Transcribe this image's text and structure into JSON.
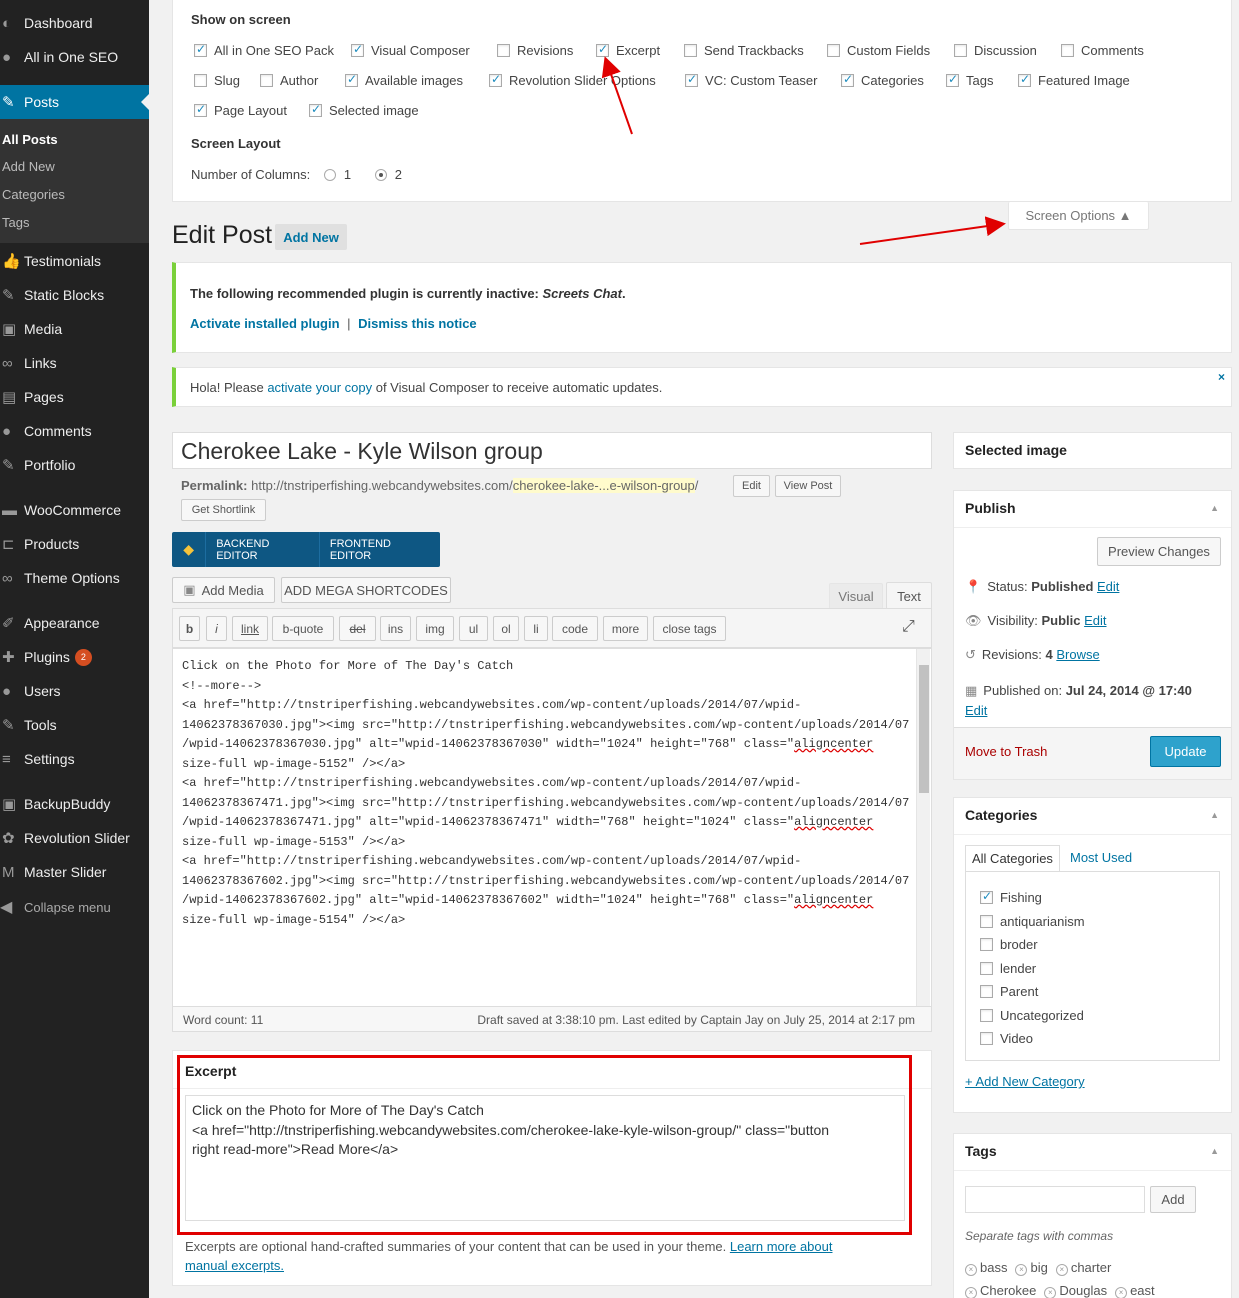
{
  "sidebar": {
    "items": [
      {
        "label": "Dashboard",
        "icon": "dashboard-icon",
        "glyph": "◐"
      },
      {
        "label": "All in One SEO",
        "icon": "seo-icon",
        "glyph": "●"
      },
      {
        "label": "Posts",
        "icon": "pin-icon",
        "glyph": "✎"
      },
      {
        "label": "Testimonials",
        "icon": "thumbs-up-icon",
        "glyph": "👍"
      },
      {
        "label": "Static Blocks",
        "icon": "pin-icon",
        "glyph": "✎"
      },
      {
        "label": "Media",
        "icon": "media-icon",
        "glyph": "▣"
      },
      {
        "label": "Links",
        "icon": "link-icon",
        "glyph": "∞"
      },
      {
        "label": "Pages",
        "icon": "page-icon",
        "glyph": "▤"
      },
      {
        "label": "Comments",
        "icon": "comment-icon",
        "glyph": "●"
      },
      {
        "label": "Portfolio",
        "icon": "pin-icon",
        "glyph": "✎"
      },
      {
        "label": "WooCommerce",
        "icon": "woo-icon",
        "glyph": "▬"
      },
      {
        "label": "Products",
        "icon": "cart-icon",
        "glyph": "⊏"
      },
      {
        "label": "Theme Options",
        "icon": "infinity-icon",
        "glyph": "∞"
      },
      {
        "label": "Appearance",
        "icon": "brush-icon",
        "glyph": "✐"
      },
      {
        "label": "Plugins",
        "icon": "plugin-icon",
        "glyph": "✚",
        "badge": "2"
      },
      {
        "label": "Users",
        "icon": "user-icon",
        "glyph": "●"
      },
      {
        "label": "Tools",
        "icon": "wrench-icon",
        "glyph": "✎"
      },
      {
        "label": "Settings",
        "icon": "settings-icon",
        "glyph": "≡"
      },
      {
        "label": "BackupBuddy",
        "icon": "backup-icon",
        "glyph": "▣"
      },
      {
        "label": "Revolution Slider",
        "icon": "gear-icon",
        "glyph": "✿"
      },
      {
        "label": "Master Slider",
        "icon": "m-icon",
        "glyph": "M"
      }
    ],
    "sub": [
      "All Posts",
      "Add New",
      "Categories",
      "Tags"
    ],
    "collapse": "Collapse menu"
  },
  "screen_options": {
    "heading": "Show on screen",
    "row1": [
      {
        "l": "All in One SEO Pack",
        "c": true
      },
      {
        "l": "Visual Composer",
        "c": true
      },
      {
        "l": "Revisions",
        "c": false
      },
      {
        "l": "Excerpt",
        "c": true
      },
      {
        "l": "Send Trackbacks",
        "c": false
      },
      {
        "l": "Custom Fields",
        "c": false
      },
      {
        "l": "Discussion",
        "c": false
      },
      {
        "l": "Comments",
        "c": false
      }
    ],
    "row2": [
      {
        "l": "Slug",
        "c": false
      },
      {
        "l": "Author",
        "c": false
      },
      {
        "l": "Available images",
        "c": true
      },
      {
        "l": "Revolution Slider Options",
        "c": true
      },
      {
        "l": "VC: Custom Teaser",
        "c": true
      },
      {
        "l": "Categories",
        "c": true
      },
      {
        "l": "Tags",
        "c": true
      },
      {
        "l": "Featured Image",
        "c": true
      }
    ],
    "row3": [
      {
        "l": "Page Layout",
        "c": true
      },
      {
        "l": "Selected image",
        "c": true
      }
    ],
    "layout_heading": "Screen Layout",
    "columns_label": "Number of Columns:",
    "col1": "1",
    "col2": "2",
    "tab": "Screen Options ▲"
  },
  "header": {
    "title": "Edit Post",
    "add_new": "Add New"
  },
  "notice1": {
    "text": "The following recommended plugin is currently inactive: ",
    "plugin": "Screets Chat",
    "period": ".",
    "activate": "Activate installed plugin",
    "sep": "|",
    "dismiss": "Dismiss this notice"
  },
  "notice2": {
    "pre": "Hola! Please ",
    "link": "activate your copy",
    "post": " of Visual Composer to receive automatic updates.",
    "close": "×"
  },
  "post": {
    "title": "Cherokee Lake - Kyle Wilson group",
    "permalink_label": "Permalink:",
    "permalink_base": "http://tnstriperfishing.webcandywebsites.com/",
    "permalink_slug": "cherokee-lake-...e-wilson-group",
    "permalink_end": "/",
    "edit": "Edit",
    "view": "View Post",
    "shortlink": "Get Shortlink"
  },
  "vc": {
    "backend": "BACKEND EDITOR",
    "frontend": "FRONTEND EDITOR"
  },
  "editor": {
    "add_media": "Add Media",
    "mega": "ADD MEGA SHORTCODES",
    "tab_visual": "Visual",
    "tab_text": "Text",
    "quicktags": [
      "b",
      "i",
      "link",
      "b-quote",
      "del",
      "ins",
      "img",
      "ul",
      "ol",
      "li",
      "code",
      "more",
      "close tags"
    ],
    "lines": [
      "Click on the Photo for More of The Day's Catch",
      "<!--more-->",
      "",
      "<a href=\"http://tnstriperfishing.webcandywebsites.com/wp-content/uploads/2014/07/wpid-",
      "14062378367030.jpg\"><img src=\"http://tnstriperfishing.webcandywebsites.com/wp-content/uploads/2014/07",
      "/wpid-14062378367030.jpg\" alt=\"wpid-14062378367030\" width=\"1024\" height=\"768\" class=\"",
      "size-full wp-image-5152\" /></a>",
      "",
      "<a href=\"http://tnstriperfishing.webcandywebsites.com/wp-content/uploads/2014/07/wpid-",
      "14062378367471.jpg\"><img src=\"http://tnstriperfishing.webcandywebsites.com/wp-content/uploads/2014/07",
      "/wpid-14062378367471.jpg\" alt=\"wpid-14062378367471\" width=\"768\" height=\"1024\" class=\"",
      "size-full wp-image-5153\" /></a>",
      "",
      "<a href=\"http://tnstriperfishing.webcandywebsites.com/wp-content/uploads/2014/07/wpid-",
      "14062378367602.jpg\"><img src=\"http://tnstriperfishing.webcandywebsites.com/wp-content/uploads/2014/07",
      "/wpid-14062378367602.jpg\" alt=\"wpid-14062378367602\" width=\"1024\" height=\"768\" class=\"",
      "size-full wp-image-5154\" /></a>"
    ],
    "aligncenter": "aligncenter",
    "word_count": "Word count: 11",
    "draft_saved": "Draft saved at 3:38:10 pm. Last edited by Captain Jay on July 25, 2014 at 2:17 pm"
  },
  "excerpt": {
    "heading": "Excerpt",
    "line1": "Click on the Photo for More of The Day's Catch",
    "line2": "<a href=\"http://tnstriperfishing.webcandywebsites.com/cherokee-lake-kyle-wilson-group/\" class=\"button",
    "line3": "right read-more\">Read More</a>",
    "help": "Excerpts are optional hand-crafted summaries of your content that can be used in your theme. ",
    "help_link1": "Learn more about",
    "help_link2": "manual excerpts."
  },
  "selected_image": {
    "heading": "Selected image"
  },
  "publish": {
    "heading": "Publish",
    "preview": "Preview Changes",
    "status_label": "Status: ",
    "status": "Published",
    "visibility_label": "Visibility: ",
    "visibility": "Public",
    "revisions_label": "Revisions: ",
    "revisions": "4",
    "browse": "Browse",
    "published_label": "Published on: ",
    "published": "Jul 24, 2014 @ 17:40",
    "edit": "Edit",
    "trash": "Move to Trash",
    "update": "Update"
  },
  "categories": {
    "heading": "Categories",
    "tab_all": "All Categories",
    "tab_used": "Most Used",
    "items": [
      {
        "l": "Fishing",
        "c": true
      },
      {
        "l": "antiquarianism",
        "c": false
      },
      {
        "l": "broder",
        "c": false
      },
      {
        "l": "lender",
        "c": false
      },
      {
        "l": "Parent",
        "c": false
      },
      {
        "l": "Uncategorized",
        "c": false
      },
      {
        "l": "Video",
        "c": false
      }
    ],
    "add_new": "+ Add New Category"
  },
  "tags": {
    "heading": "Tags",
    "add": "Add",
    "help": "Separate tags with commas",
    "list": [
      "bass",
      "big",
      "charter",
      "Cherokee",
      "Douglas",
      "east"
    ]
  },
  "colors": {
    "accent": "#0074a2",
    "sidebar": "#222222",
    "annotation": "#e00000",
    "update": "#2ea2cc"
  }
}
